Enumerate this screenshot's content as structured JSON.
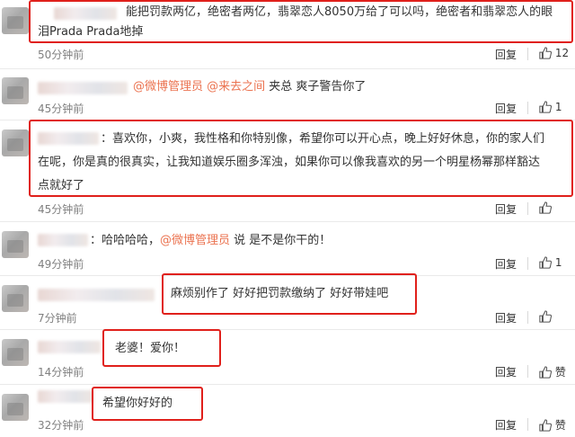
{
  "comments": [
    {
      "lines": [
        "能把罚款两亿，绝密者两亿，翡翠恋人8050万给了可以吗，绝密者和翡翠恋人的眼",
        "泪Prada Prada地掉"
      ],
      "time": "50分钟前",
      "reply": "回复",
      "likes": "12"
    },
    {
      "mention1": "@微博管理员",
      "mention2": "@来去之间",
      "after": " 夹总 爽子警告你了",
      "time": "45分钟前",
      "reply": "回复",
      "likes": "1"
    },
    {
      "lines": [
        "：喜欢你，小爽，我性格和你特别像，希望你可以开心点，晚上好好休息，你的家人们",
        "在呢，你是真的很真实，让我知道娱乐圈多浑浊，如果你可以像我喜欢的另一个明星杨幂那样豁达",
        "点就好了"
      ],
      "time": "45分钟前",
      "reply": "回复",
      "likes": ""
    },
    {
      "before": "：哈哈哈哈，",
      "mention": "@微博管理员",
      "after": " 说 是不是你干的！",
      "time": "49分钟前",
      "reply": "回复",
      "likes": "1"
    },
    {
      "text": "麻烦别作了 好好把罚款缴纳了 好好带娃吧",
      "time": "7分钟前",
      "reply": "回复",
      "likes": ""
    },
    {
      "text": "老婆！爱你！",
      "time": "14分钟前",
      "reply": "回复",
      "likes": "赞"
    },
    {
      "text": "希望你好好的",
      "time": "32分钟前",
      "reply": "回复",
      "likes": "赞"
    }
  ],
  "colors": {
    "highlight_box": "#e0201b",
    "mention": "#eb7350",
    "timestamp": "#808080"
  },
  "icons": {
    "like": "thumbs-up-icon"
  }
}
